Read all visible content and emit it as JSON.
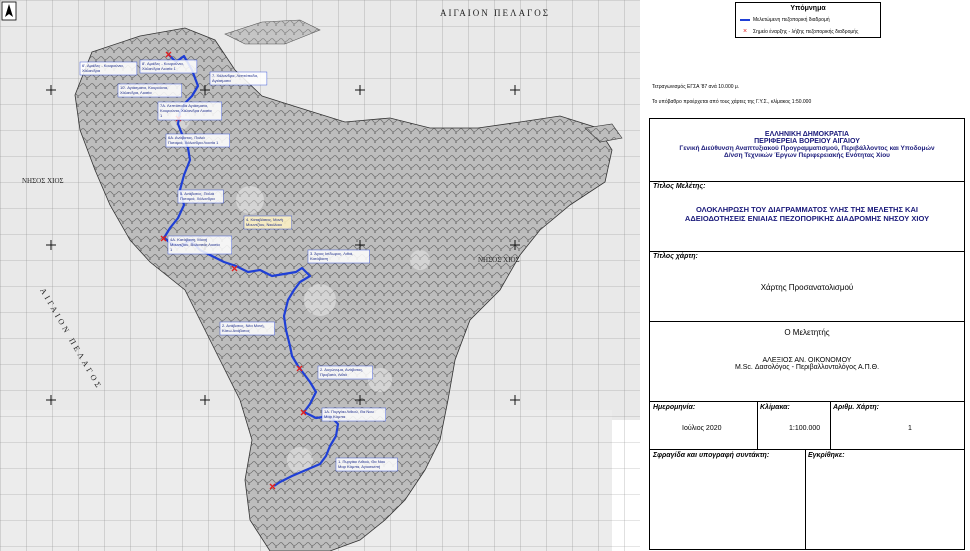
{
  "legend": {
    "title": "Υπόμνημα",
    "route_label": "Μελετώμενη πεζοπορική διαδρομή",
    "marker_label": "Σημείο έναρξης - λήξης πεζοπορικής διαδρομής",
    "route_color": "#1f3fd6",
    "marker_color": "#e02020"
  },
  "notes": {
    "grid_note": "Τετραγωνισμός ΕΓΣΑ '87 ανά 10.000 μ.",
    "base_note": "Το υπόβαθρο προέρχεται από τους χάρτες της Γ.Υ.Σ., κλίμακος 1:50.000"
  },
  "header": {
    "line1": "ΕΛΛΗΝΙΚΗ ΔΗΜΟΚΡΑΤΙΑ",
    "line2": "ΠΕΡΙΦΕΡΕΙΑ ΒΟΡΕΙΟΥ ΑΙΓΑΙΟΥ",
    "line3": "Γενική Διεύθυνση Αναπτυξιακού Προγραμματισμού, Περιβάλλοντος και Υποδομών",
    "line4": "Δ/νση Τεχνικών Έργων Περιφερειακής Ενότητας Χίου"
  },
  "study": {
    "label": "Τίτλος Μελέτης:",
    "line1": "ΟΛΟΚΛΗΡΩΣΗ ΤΟΥ ΔΙΑΓΡΑΜΜΑΤΟΣ ΥΛΗΣ ΤΗΣ ΜΕΛΕΤΗΣ ΚΑΙ",
    "line2": "ΑΔΕΙΟΔΟΤΗΣΕΙΣ ΕΝΙΑΙΑΣ ΠΕΖΟΠΟΡΙΚΗΣ ΔΙΑΔΡΟΜΗΣ ΝΗΣΟΥ ΧΙΟΥ"
  },
  "map_title": {
    "label": "Τίτλος χάρτη:",
    "value": "Χάρτης Προσανατολισμού"
  },
  "author": {
    "heading": "Ο Μελετητής",
    "name": "ΑΛΕΞΙΟΣ ΑΝ. ΟΙΚΟΝΟΜΟΥ",
    "title": "M.Sc. Δασολόγος - Περιβαλλοντολόγος Α.Π.Θ."
  },
  "meta": {
    "date_label": "Ημερομηνία:",
    "date_value": "Ιούλιος 2020",
    "scale_label": "Κλίμακα:",
    "scale_value": "1:100.000",
    "sheet_label": "Αριθμ. Χάρτη:",
    "sheet_value": "1"
  },
  "signature": {
    "stamp_label": "Σφραγίδα και υπογραφή συντάκτη:",
    "approval_label": "Εγκρίθηκε:"
  },
  "map": {
    "north_symbol": "N",
    "sea_label_top": "ΑΙΓΑΙΟΝ ΠΕΛΑΓΟΣ",
    "island_label_left": "ΝΗΣΟΣ ΧΙΟΣ",
    "island_label_center": "ΝΗΣΟΣ ΧΙΟΣ",
    "sea_label_left": "ΑΙΓΑΙΟΝ ΠΕΛΑΓΟΣ",
    "route_labels": [
      "6'. Αμάδες - Κουρούνια, Χάλανδρα",
      "8'. Αμάδες - Κουρούνια, Χάλανδρα Λιοσία 1",
      "7. Χάλανδρα, Λεπτόποδα, Αγιάσματα",
      "10'. Αγιάσματα, Κουρούνια, Χάλανδρα, Λιοσία",
      "7Α. Λεπτόποδα Αγιάσματα, Κουρούνια, Χάλανδρα Λιοσία 1",
      "6Α. Ανάβατος, Παλιά Ποταμιά, Χάλανδρα Λιοσία 1",
      "5. Ανάβατος, Παλιά Ποταμιά, Χάλανδρα",
      "4. Καταβάσεις, Μονή Μουντζίου, Νικόλαοι",
      "4Α. Κατάβαση, Μονή Μουντζίου, Βολισσός Λιοσία 1",
      "3. Άγιος Ισίδωρος, Λιθιά, Κατάβαση",
      "2. Ανάβατος, Νέα Μονή, Κάτω Ανάβατος",
      "2. Αυγώνυμα, Ανάβατος, Προβατά, Λιθιά",
      "1Α. Πυργάκι Λιθιού, Θα Ναυ Μαρ Κάμπα",
      "1. Πυργάκι Λιθιού, Θα Ναυ Μαρ Κάμπα, Αγιοσκεπή"
    ]
  }
}
